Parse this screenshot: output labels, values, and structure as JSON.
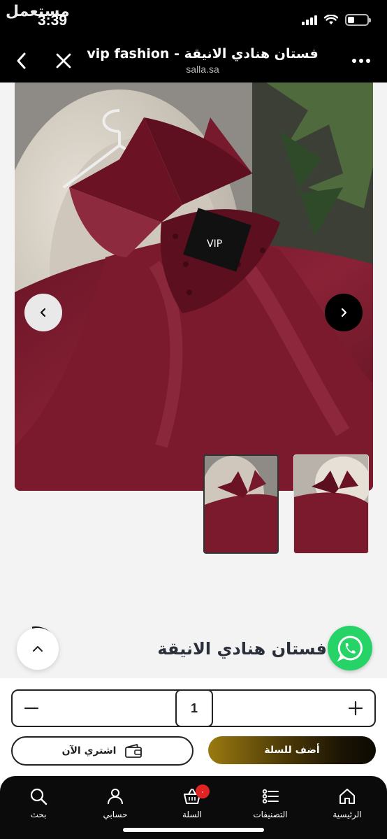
{
  "status_bar": {
    "time": "3:39",
    "watermark": "مستعمل"
  },
  "browser": {
    "title": "فستان هنادي الانيقة - vip fashion",
    "domain": "salla.sa",
    "icons": [
      "chevron-left-icon",
      "close-icon",
      "more-horizontal-icon"
    ]
  },
  "product": {
    "name": "فستان هنادي الانيقة",
    "image_alt": "burgundy satin dress with bow",
    "thumbnail_count": 2,
    "colors": {
      "dress": "#7a1a2c",
      "dress_dark": "#4d0e1b",
      "chair": "#d9d2c8"
    }
  },
  "cart": {
    "quantity": "1",
    "minus_label": "−",
    "plus_label": "+",
    "buy_now_label": "اشتري الآن",
    "add_to_cart_label": "أضف للسلة"
  },
  "bottom_nav": {
    "items": [
      {
        "label": "الرئيسية",
        "icon": "home-icon"
      },
      {
        "label": "التصنيفات",
        "icon": "list-icon"
      },
      {
        "label": "السلة",
        "icon": "basket-icon",
        "badge": "٠"
      },
      {
        "label": "حسابي",
        "icon": "user-icon"
      },
      {
        "label": "بحث",
        "icon": "search-icon"
      }
    ]
  },
  "accent_colors": {
    "whatsapp": "#25d366",
    "badge": "#e02424",
    "add_to_cart_gold": "#9a7a10"
  }
}
